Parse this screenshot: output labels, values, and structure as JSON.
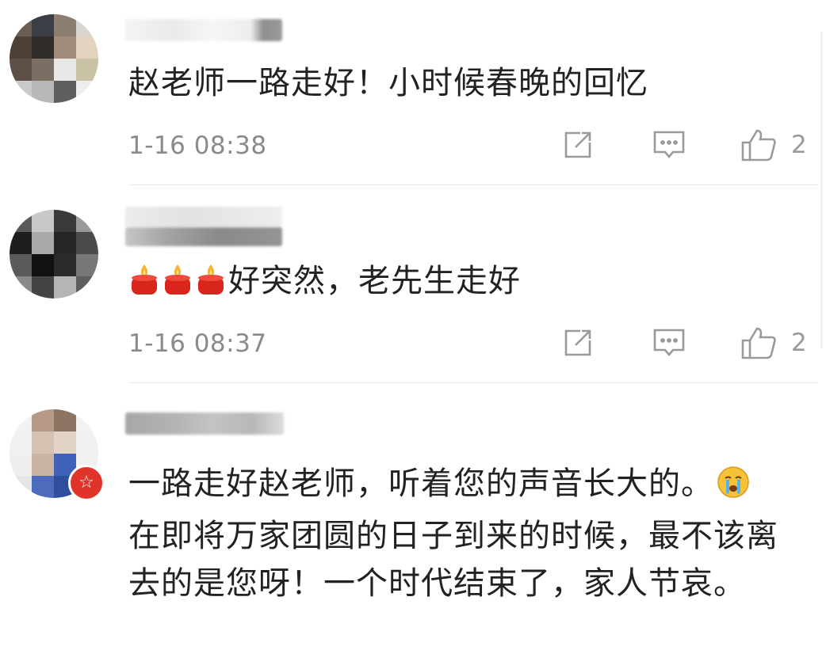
{
  "comments": [
    {
      "text": "赵老师一路走好！小时候春晚的回忆",
      "time": "1-16 08:38",
      "likes": "2"
    },
    {
      "text": "好突然，老先生走好",
      "time": "1-16 08:37",
      "likes": "2"
    },
    {
      "text": "一路走好赵老师，听着您的声音长大的。",
      "text_cont": "在即将万家团圆的日子到来的时候，最不该离去的是您呀！一个时代结束了，家人节哀。"
    }
  ],
  "icons": {
    "share": "share-icon",
    "reply": "comment-icon",
    "like": "thumbs-up-icon",
    "candle": "candle-emoji",
    "crying": "crying-face-emoji"
  },
  "colors": {
    "text": "#222222",
    "meta": "#8a8a8a",
    "icon": "#9a9a9a",
    "badge": "#e0332a",
    "divider": "#e9e9e9"
  }
}
